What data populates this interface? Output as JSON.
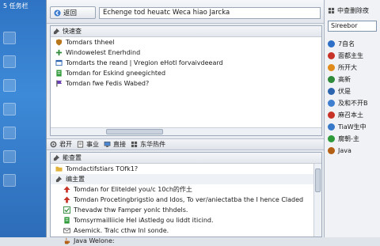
{
  "desktop": {
    "title": "5 任务栏"
  },
  "toolbar": {
    "back_label": "返回",
    "address": "Echenge tod heuatc Weca hiao Jarcka"
  },
  "top_panel": {
    "header": "快速查",
    "items": [
      {
        "label": "Tomdars thheel",
        "icon": "shield-icon",
        "color": "#b9771b"
      },
      {
        "label": "Windowelest Enerhdind",
        "icon": "plus-icon",
        "color": "#2f8a3a"
      },
      {
        "label": "Tomdarts the reand | Vregion eHotl forvaivdeeard",
        "icon": "window-icon",
        "color": "#2c64b0"
      },
      {
        "label": "Tomdan for Eskind gneegichted",
        "icon": "page-icon",
        "color": "#2f9a3a"
      },
      {
        "label": "Tomdan fwe Fedis Wabed?",
        "icon": "flag-icon",
        "color": "#6a3fb3"
      }
    ]
  },
  "tabs": [
    {
      "label": "君开",
      "icon": "gear-icon"
    },
    {
      "label": "事业",
      "icon": "doc-icon"
    },
    {
      "label": "直接",
      "icon": "monitor-icon"
    },
    {
      "label": "东华热件",
      "icon": "grid-icon"
    }
  ],
  "bottom_panel": {
    "header": "能查置",
    "sub_item": "Tomdactifstiars TOfk1?",
    "group": "编主置",
    "items": [
      {
        "label": "Tomdan for Eliteldel you/c 10ch的作土",
        "icon": "arrow-up-icon",
        "color": "#c73328"
      },
      {
        "label": "Tomdan Procetingbrigstio and ldos, To ver/aniectatba the I hence Claded",
        "icon": "arrow-up-icon",
        "color": "#c73328"
      },
      {
        "label": "Thevadw thw Famper yonlc thhdels.",
        "icon": "check-icon",
        "color": "#2f8a3a"
      },
      {
        "label": "Tomsyrmailliicie HeI iAstledg ou liddt iticind.",
        "icon": "page-icon",
        "color": "#2f9a3a"
      },
      {
        "label": "Asemick. Tralc cthw lnl sonde.",
        "icon": "mail-icon",
        "color": "#6b6b6b"
      },
      {
        "label": "Java Welone:",
        "icon": "java-icon",
        "color": "#b35f14"
      }
    ]
  },
  "side": {
    "header": "中查删除夜",
    "search_value": "Sireebor",
    "items": [
      {
        "label": "7自名",
        "color": "#2e6fc7"
      },
      {
        "label": "面都主生",
        "color": "#c73328"
      },
      {
        "label": "所开大",
        "color": "#e08a1c"
      },
      {
        "label": "高新",
        "color": "#2f8a3a"
      },
      {
        "label": "伏是",
        "color": "#2c64b0"
      },
      {
        "label": "及和不开B",
        "color": "#3f7fd0"
      },
      {
        "label": "麻召本土",
        "color": "#c73328"
      },
      {
        "label": "TiaW生中",
        "color": "#3778c8"
      },
      {
        "label": "腐朝-主",
        "color": "#2f9a3a"
      },
      {
        "label": "Java",
        "color": "#b35f14"
      }
    ]
  }
}
